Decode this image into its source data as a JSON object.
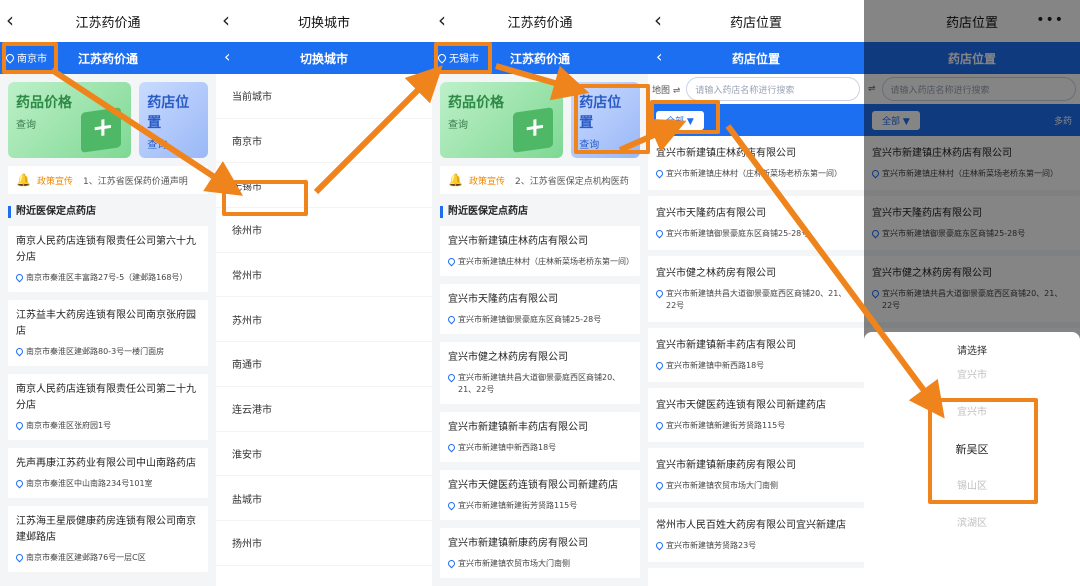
{
  "panel1": {
    "nav_title": "江苏药价通",
    "blue_title": "江苏药价通",
    "city": "南京市",
    "card1_title": "药品价格",
    "card1_sub": "查询",
    "card2_title": "药店位置",
    "card2_sub": "查询",
    "notice_label": "政策宣传",
    "notice_text": "1、江苏省医保药价通声明",
    "section": "附近医保定点药店",
    "items": [
      {
        "name": "南京人民药店连锁有限责任公司第六十九分店",
        "addr": "南京市秦淮区丰富路27号-5（建邺路168号）"
      },
      {
        "name": "江苏益丰大药房连锁有限公司南京张府园店",
        "addr": "南京市秦淮区建邺路80-3号一楼门面房"
      },
      {
        "name": "南京人民药店连锁有限责任公司第二十九分店",
        "addr": "南京市秦淮区张府园1号"
      },
      {
        "name": "先声再康江苏药业有限公司中山南路药店",
        "addr": "南京市秦淮区中山南路234号101室"
      },
      {
        "name": "江苏海王星辰健康药房连锁有限公司南京建邺路店",
        "addr": "南京市秦淮区建邺路76号一层C区"
      }
    ]
  },
  "panel2": {
    "nav_title": "切换城市",
    "blue_title": "切换城市",
    "cities": [
      "当前城市",
      "南京市",
      "无锡市",
      "徐州市",
      "常州市",
      "苏州市",
      "南通市",
      "连云港市",
      "淮安市",
      "盐城市",
      "扬州市"
    ]
  },
  "panel3": {
    "nav_title": "江苏药价通",
    "blue_title": "江苏药价通",
    "city": "无锡市",
    "card1_title": "药品价格",
    "card1_sub": "查询",
    "card2_title": "药店位置",
    "card2_sub": "查询",
    "notice_label": "政策宣传",
    "notice_text": "2、江苏省医保定点机构医药",
    "section": "附近医保定点药店",
    "items": [
      {
        "name": "宜兴市新建镇庄林药店有限公司",
        "addr": "宜兴市新建镇庄林村（庄林新菜场老桥东第一间）"
      },
      {
        "name": "宜兴市天隆药店有限公司",
        "addr": "宜兴市新建镇御景豪庭东区商铺25-28号"
      },
      {
        "name": "宜兴市健之林药房有限公司",
        "addr": "宜兴市新建镇共昌大道御景豪庭西区商铺20、21、22号"
      },
      {
        "name": "宜兴市新建镇新丰药店有限公司",
        "addr": "宜兴市新建镇中新西路18号"
      },
      {
        "name": "宜兴市天健医药连锁有限公司新建药店",
        "addr": "宜兴市新建镇新建街芳贤路115号"
      },
      {
        "name": "宜兴市新建镇新康药房有限公司",
        "addr": "宜兴市新建镇农贸市场大门南侧"
      }
    ]
  },
  "panel4": {
    "nav_title": "药店位置",
    "blue_title": "药店位置",
    "map_label": "地图 ⇌",
    "search_placeholder": "请输入药店名称进行搜索",
    "filter_all": "全部 ▼",
    "items": [
      {
        "name": "宜兴市新建镇庄林药店有限公司",
        "addr": "宜兴市新建镇庄林村（庄林新菜场老桥东第一间）"
      },
      {
        "name": "宜兴市天隆药店有限公司",
        "addr": "宜兴市新建镇御景豪庭东区商铺25-28号"
      },
      {
        "name": "宜兴市健之林药房有限公司",
        "addr": "宜兴市新建镇共昌大道御景豪庭西区商铺20、21、22号"
      },
      {
        "name": "宜兴市新建镇新丰药店有限公司",
        "addr": "宜兴市新建镇中新西路18号"
      },
      {
        "name": "宜兴市天健医药连锁有限公司新建药店",
        "addr": "宜兴市新建镇新建街芳贤路115号"
      },
      {
        "name": "宜兴市新建镇新康药房有限公司",
        "addr": "宜兴市新建镇农贸市场大门南侧"
      },
      {
        "name": "常州市人民百姓大药房有限公司宜兴新建店",
        "addr": "宜兴市新建镇芳贤路23号"
      }
    ]
  },
  "panel5": {
    "nav_title": "药店位置",
    "more": "•••",
    "blue_title": "药店位置",
    "map_label": "⇌",
    "search_placeholder": "请输入药店名称进行搜索",
    "filter_all": "全部 ▼",
    "filter_multi": "多药",
    "items": [
      {
        "name": "宜兴市新建镇庄林药店有限公司",
        "addr": "宜兴市新建镇庄林村（庄林新菜场老桥东第一间）"
      },
      {
        "name": "宜兴市天隆药店有限公司",
        "addr": "宜兴市新建镇御景豪庭东区商铺25-28号"
      },
      {
        "name": "宜兴市健之林药房有限公司",
        "addr": "宜兴市新建镇共昌大道御景豪庭西区商铺20、21、22号"
      }
    ],
    "sheet_title": "请选择",
    "options": [
      "宜兴市",
      "宜兴市",
      "新吴区",
      "锡山区",
      "滨湖区"
    ]
  },
  "highlight_color": "#f0841c",
  "brand_blue": "#1d6ff2"
}
